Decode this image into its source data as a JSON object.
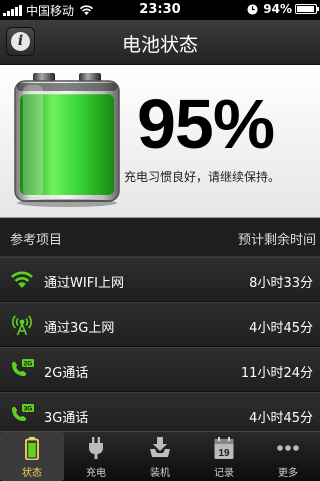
{
  "status_bar": {
    "carrier": "中国移动",
    "time": "23:30",
    "battery_percent": "94%",
    "battery_level": 0.94,
    "signal_icon": "signal-bars-icon",
    "wifi_icon": "wifi-icon",
    "alarm_icon": "clock-icon"
  },
  "nav": {
    "title": "电池状态",
    "info_icon": "info-icon",
    "info_glyph": "i"
  },
  "hero": {
    "percent": "95%",
    "level": 0.95,
    "advice": "充电习惯良好，请继续保持。",
    "battery_color": "#3cd93c"
  },
  "list": {
    "header_left": "参考项目",
    "header_right": "预计剩余时间",
    "rows": [
      {
        "label": "通过WIFI上网",
        "value": "8小时33分",
        "icon": "wifi-icon"
      },
      {
        "label": "通过3G上网",
        "value": "4小时45分",
        "icon": "antenna-icon"
      },
      {
        "label": "2G通话",
        "value": "11小时24分",
        "icon": "phone-2g-icon",
        "badge": "2G"
      },
      {
        "label": "3G通话",
        "value": "4小时45分",
        "icon": "phone-3g-icon",
        "badge": "3G"
      }
    ]
  },
  "tabs": [
    {
      "label": "状态",
      "icon": "battery-icon",
      "active": true
    },
    {
      "label": "充电",
      "icon": "plug-icon",
      "active": false
    },
    {
      "label": "装机",
      "icon": "download-tray-icon",
      "active": false
    },
    {
      "label": "记录",
      "icon": "calendar-icon",
      "active": false,
      "badge": "19"
    },
    {
      "label": "更多",
      "icon": "more-dots-icon",
      "active": false
    }
  ],
  "colors": {
    "accent_green": "#5ed21e",
    "tab_active_label": "#f2d45a"
  }
}
